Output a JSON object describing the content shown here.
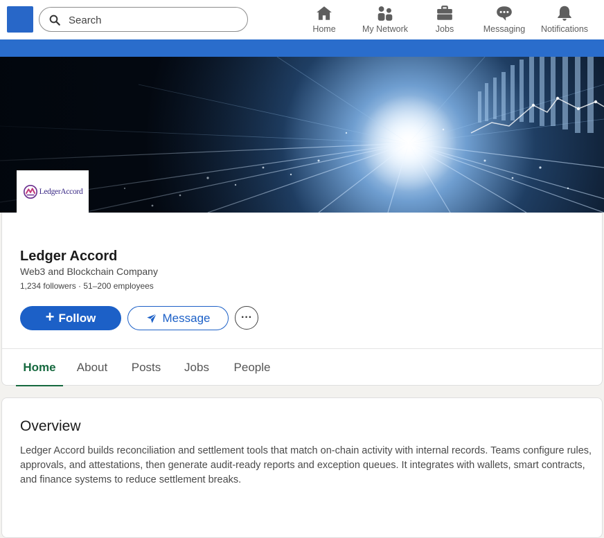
{
  "colors": {
    "brand_blue": "#2867c8",
    "follow_button": "#1c60c7",
    "active_tab": "#16693f",
    "logo_text": "#3b2a86"
  },
  "search": {
    "placeholder": "Search",
    "icon": "search-icon"
  },
  "nav": {
    "home": {
      "label": "Home",
      "icon": "home-icon"
    },
    "network": {
      "label": "My Network",
      "icon": "people-icon"
    },
    "jobs": {
      "label": "Jobs",
      "icon": "briefcase-icon"
    },
    "messaging": {
      "label": "Messaging",
      "icon": "chat-bubble-icon"
    },
    "notifications": {
      "label": "Notifications",
      "icon": "bell-icon"
    }
  },
  "company": {
    "logo_text": "LedgerAccord",
    "name": "Ledger Accord",
    "tagline": "Web3 and Blockchain Company",
    "stats": "1,234 followers · 51–200 employees"
  },
  "actions": {
    "follow_label": "Follow",
    "message_label": "Message",
    "more_label": "···"
  },
  "tabs": {
    "home": "Home",
    "about": "About",
    "posts": "Posts",
    "jobs": "Jobs",
    "people": "People",
    "active": "Home"
  },
  "overview": {
    "title": "Overview",
    "text": "Ledger Accord builds reconciliation and settlement tools that match on-chain activity with internal records. Teams configure rules, approvals, and attestations, then generate audit-ready reports and exception queues. It integrates with wallets, smart contracts, and finance systems to reduce settlement breaks."
  }
}
